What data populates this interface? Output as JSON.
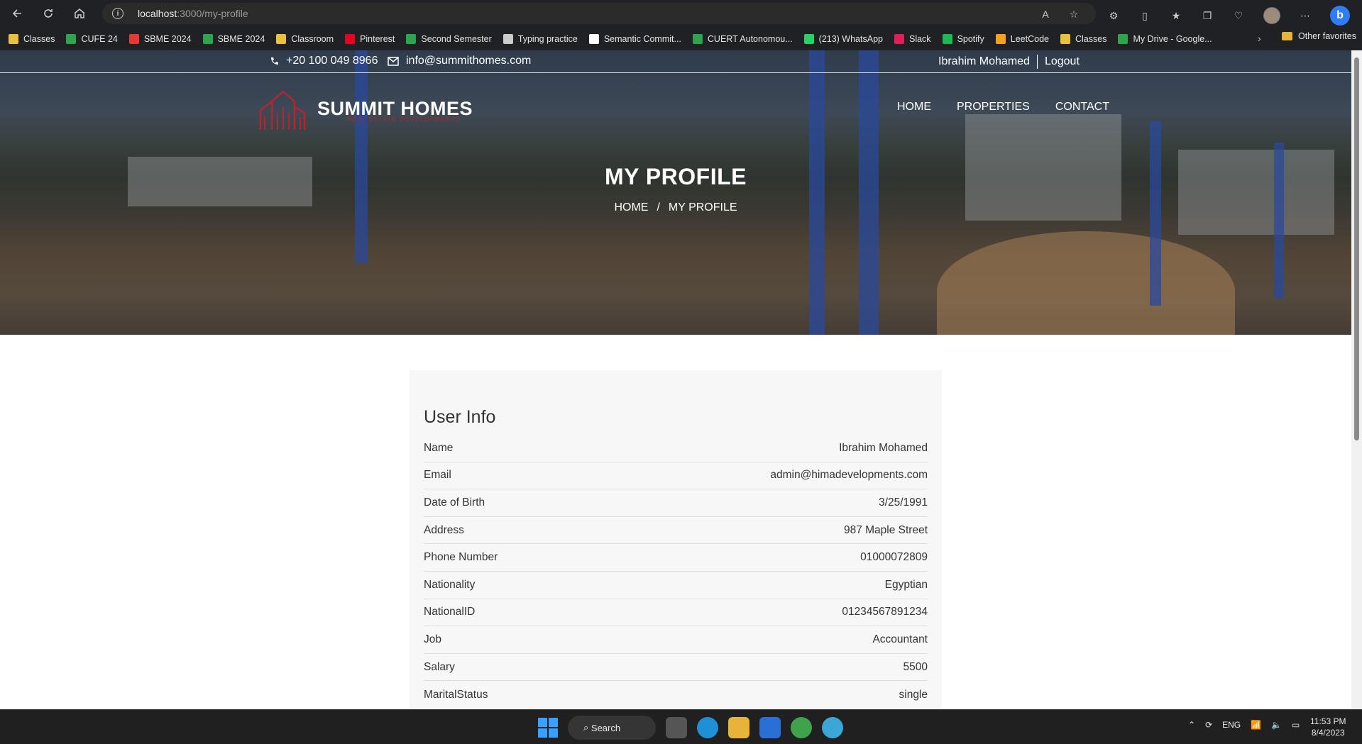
{
  "browser": {
    "url_host": "localhost",
    "url_path": ":3000/my-profile",
    "bookmarks": [
      {
        "label": "Classes",
        "color": "#e8c23a"
      },
      {
        "label": "CUFE 24",
        "color": "#2da44e"
      },
      {
        "label": "SBME 2024",
        "color": "#e53935"
      },
      {
        "label": "SBME 2024",
        "color": "#2da44e"
      },
      {
        "label": "Classroom",
        "color": "#e8c23a"
      },
      {
        "label": "Pinterest",
        "color": "#e60023"
      },
      {
        "label": "Second Semester",
        "color": "#2da44e"
      },
      {
        "label": "Typing practice",
        "color": "#cccccc"
      },
      {
        "label": "Semantic Commit...",
        "color": "#ffffff"
      },
      {
        "label": "CUERT Autonomou...",
        "color": "#2da44e"
      },
      {
        "label": "(213) WhatsApp",
        "color": "#25d366"
      },
      {
        "label": "Slack",
        "color": "#e01e5a"
      },
      {
        "label": "Spotify",
        "color": "#1db954"
      },
      {
        "label": "LeetCode",
        "color": "#f89f1b"
      },
      {
        "label": "Classes",
        "color": "#e8c23a"
      },
      {
        "label": "My Drive - Google...",
        "color": "#2da44e"
      }
    ],
    "other_favorites": "Other favorites"
  },
  "topbar": {
    "phone": "+20 100 049 8966",
    "email": "info@summithomes.com",
    "user_name": "Ibrahim Mohamed",
    "logout": "Logout"
  },
  "brand": {
    "name": "SUMMIT HOMES",
    "tagline": "REAL ESTATE DEVELOPMENTS",
    "accent": "#b3262f"
  },
  "menu": {
    "home": "HOME",
    "properties": "PROPERTIES",
    "contact": "CONTACT"
  },
  "hero": {
    "title": "MY PROFILE",
    "crumb_home": "HOME",
    "crumb_sep": "/",
    "crumb_current": "MY PROFILE"
  },
  "user_info": {
    "heading": "User Info",
    "rows": [
      {
        "label": "Name",
        "value": "Ibrahim Mohamed"
      },
      {
        "label": "Email",
        "value": "admin@himadevelopments.com"
      },
      {
        "label": "Date of Birth",
        "value": "3/25/1991"
      },
      {
        "label": "Address",
        "value": "987 Maple Street"
      },
      {
        "label": "Phone Number",
        "value": "01000072809"
      },
      {
        "label": "Nationality",
        "value": "Egyptian"
      },
      {
        "label": "NationalID",
        "value": "01234567891234"
      },
      {
        "label": "Job",
        "value": "Accountant"
      },
      {
        "label": "Salary",
        "value": "5500"
      },
      {
        "label": "MaritalStatus",
        "value": "single"
      }
    ]
  },
  "taskbar": {
    "search": "Search",
    "lang": "ENG",
    "time": "11:53 PM",
    "date": "8/4/2023"
  }
}
